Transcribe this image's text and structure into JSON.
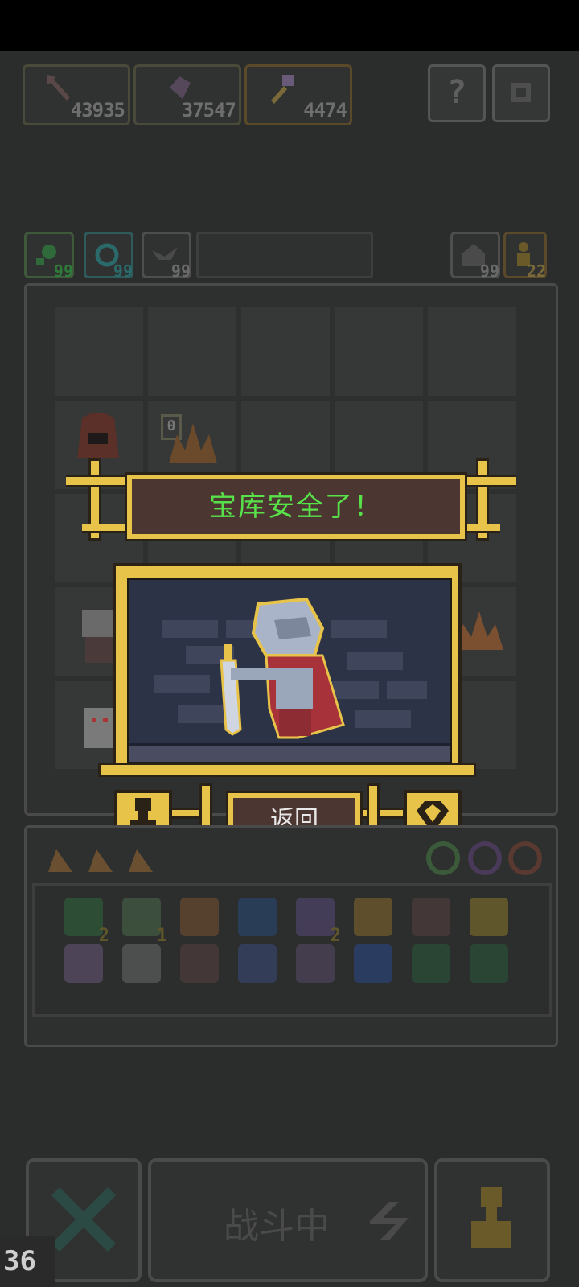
{
  "currencies": [
    {
      "icon": "spear-icon",
      "value": "43935"
    },
    {
      "icon": "gem-icon",
      "value": "37547"
    },
    {
      "icon": "key-icon",
      "value": "4474"
    }
  ],
  "top_buttons": {
    "help_label": "?",
    "settings_icon": "gear-icon"
  },
  "resources_left": [
    {
      "icon": "green-orb-icon",
      "count": "99"
    },
    {
      "icon": "cyan-swirl-icon",
      "count": "99"
    },
    {
      "icon": "bird-icon",
      "count": "99"
    }
  ],
  "resources_right": [
    {
      "icon": "house-icon",
      "count": "99"
    },
    {
      "icon": "pawn-icon",
      "count": "22"
    }
  ],
  "board": {
    "counter": "0"
  },
  "modal": {
    "title": "宝库安全了！",
    "back_label": "返回",
    "left_icon": "pawn-icon",
    "right_icon": "diamond-icon"
  },
  "inventory": {
    "row1": [
      {
        "icon": "green-gem-icon",
        "count": "2"
      },
      {
        "icon": "soldier-icon",
        "count": "1"
      },
      {
        "icon": "shield-icon",
        "count": ""
      },
      {
        "icon": "blue-potion-card-icon",
        "count": ""
      },
      {
        "icon": "hourglass-icon",
        "count": "2"
      },
      {
        "icon": "hammer-icon",
        "count": ""
      },
      {
        "icon": "arrow-icon",
        "count": ""
      },
      {
        "icon": "goblet-icon",
        "count": ""
      }
    ],
    "row2": [
      {
        "icon": "key-icon",
        "count": ""
      },
      {
        "icon": "shuriken-icon",
        "count": ""
      },
      {
        "icon": "arrow-icon",
        "count": ""
      },
      {
        "icon": "blue-swirl-icon",
        "count": ""
      },
      {
        "icon": "purple-swirl-icon",
        "count": ""
      },
      {
        "icon": "blue-flame-card-icon",
        "count": ""
      },
      {
        "icon": "green-map-icon",
        "count": ""
      },
      {
        "icon": "green-map-icon",
        "count": ""
      }
    ]
  },
  "bottom": {
    "battle_label": "战斗中",
    "level": "36"
  },
  "colors": {
    "gold": "#e8c34a",
    "title_green": "#58e24a",
    "panel_brown": "#4b3631",
    "bg": "#2b2c2c"
  }
}
